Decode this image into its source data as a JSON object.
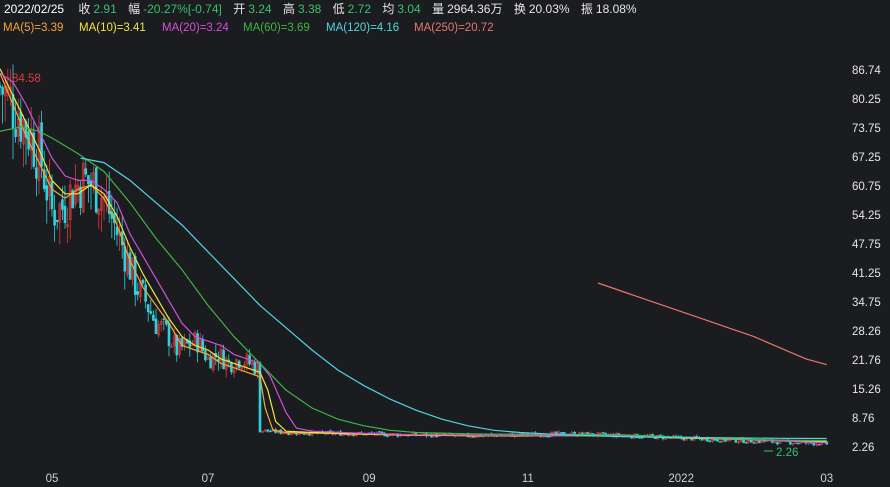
{
  "header": {
    "date": "2022/02/25",
    "close_label": "收",
    "close_value": "2.91",
    "change_label": "幅",
    "change_value": "-20.27%[-0.74]",
    "open_label": "开",
    "open_value": "3.24",
    "high_label": "高",
    "high_value": "3.38",
    "low_label": "低",
    "low_value": "2.72",
    "avg_label": "均",
    "avg_value": "3.04",
    "volume_label": "量",
    "volume_value": "2964.36万",
    "turnover_label": "换",
    "turnover_value": "20.03%",
    "amplitude_label": "振",
    "amplitude_value": "18.08%"
  },
  "ma_legend": [
    {
      "text": "MA(5)=3.39",
      "color": "#f0a63a"
    },
    {
      "text": "MA(10)=3.41",
      "color": "#f2e33c"
    },
    {
      "text": "MA(20)=3.24",
      "color": "#d34fd8"
    },
    {
      "text": "MA(60)=3.69",
      "color": "#3fb43f"
    },
    {
      "text": "MA(120)=4.16",
      "color": "#4fd6e0"
    },
    {
      "text": "MA(250)=20.72",
      "color": "#e8756e"
    }
  ],
  "annotations": {
    "high_mark": "84.58",
    "low_mark": "2.26"
  },
  "chart_data": {
    "type": "line",
    "y_ticks": [
      "86.74",
      "80.25",
      "73.75",
      "67.25",
      "60.75",
      "54.25",
      "47.75",
      "41.25",
      "34.75",
      "28.26",
      "21.76",
      "15.26",
      "8.76",
      "2.26"
    ],
    "x_ticks": [
      {
        "label": "05",
        "x": 20,
        "highlight": false
      },
      {
        "label": "07",
        "x": 80,
        "highlight": false
      },
      {
        "label": "09",
        "x": 142,
        "highlight": false
      },
      {
        "label": "11",
        "x": 203,
        "highlight": false
      },
      {
        "label": "2022",
        "x": 262,
        "highlight": true
      },
      {
        "label": "03",
        "x": 318,
        "highlight": false
      }
    ],
    "ylim": [
      2.26,
      86.74
    ],
    "xlim": [
      0,
      320
    ],
    "grid": false,
    "colors": {
      "up": "#e03a3a",
      "down": "#2fd2de"
    },
    "series": [
      {
        "name": "MA(5)",
        "color": "#f0a63a",
        "values": [
          [
            0,
            86
          ],
          [
            5,
            79
          ],
          [
            10,
            72
          ],
          [
            15,
            66
          ],
          [
            20,
            60
          ],
          [
            25,
            58
          ],
          [
            30,
            60
          ],
          [
            35,
            61
          ],
          [
            40,
            58
          ],
          [
            45,
            52
          ],
          [
            50,
            44
          ],
          [
            55,
            38
          ],
          [
            60,
            34
          ],
          [
            65,
            30
          ],
          [
            70,
            25
          ],
          [
            75,
            24
          ],
          [
            80,
            23
          ],
          [
            85,
            21
          ],
          [
            90,
            20
          ],
          [
            95,
            19
          ],
          [
            100,
            18
          ],
          [
            102,
            11
          ],
          [
            105,
            6
          ],
          [
            110,
            5.5
          ],
          [
            120,
            5.4
          ],
          [
            140,
            5.1
          ],
          [
            160,
            4.9
          ],
          [
            180,
            4.8
          ],
          [
            200,
            4.7
          ],
          [
            220,
            4.9
          ],
          [
            240,
            4.7
          ],
          [
            260,
            4.3
          ],
          [
            280,
            4.0
          ],
          [
            300,
            3.7
          ],
          [
            318,
            3.4
          ]
        ]
      },
      {
        "name": "MA(10)",
        "color": "#f2e33c",
        "values": [
          [
            0,
            87
          ],
          [
            5,
            81
          ],
          [
            10,
            75
          ],
          [
            15,
            69
          ],
          [
            20,
            62
          ],
          [
            25,
            59
          ],
          [
            30,
            59
          ],
          [
            35,
            61
          ],
          [
            40,
            59
          ],
          [
            45,
            54
          ],
          [
            50,
            47
          ],
          [
            55,
            41
          ],
          [
            60,
            36
          ],
          [
            65,
            31
          ],
          [
            70,
            27
          ],
          [
            75,
            25
          ],
          [
            80,
            24
          ],
          [
            85,
            22
          ],
          [
            90,
            21
          ],
          [
            95,
            20
          ],
          [
            100,
            19
          ],
          [
            103,
            15
          ],
          [
            106,
            8
          ],
          [
            110,
            5.8
          ],
          [
            120,
            5.5
          ],
          [
            140,
            5.2
          ],
          [
            160,
            4.9
          ],
          [
            180,
            4.8
          ],
          [
            200,
            4.8
          ],
          [
            220,
            4.8
          ],
          [
            240,
            4.7
          ],
          [
            260,
            4.4
          ],
          [
            280,
            4.1
          ],
          [
            300,
            3.7
          ],
          [
            318,
            3.4
          ]
        ]
      },
      {
        "name": "MA(20)",
        "color": "#d34fd8",
        "values": [
          [
            0,
            86
          ],
          [
            5,
            84
          ],
          [
            10,
            79
          ],
          [
            15,
            73
          ],
          [
            20,
            67
          ],
          [
            25,
            63
          ],
          [
            30,
            62
          ],
          [
            35,
            62
          ],
          [
            40,
            60
          ],
          [
            45,
            57
          ],
          [
            50,
            50
          ],
          [
            55,
            45
          ],
          [
            60,
            40
          ],
          [
            65,
            35
          ],
          [
            70,
            30
          ],
          [
            75,
            27
          ],
          [
            80,
            26
          ],
          [
            85,
            25
          ],
          [
            90,
            23
          ],
          [
            95,
            22
          ],
          [
            100,
            21
          ],
          [
            104,
            18
          ],
          [
            110,
            10
          ],
          [
            114,
            6.5
          ],
          [
            120,
            5.8
          ],
          [
            140,
            5.3
          ],
          [
            160,
            5.0
          ],
          [
            180,
            4.9
          ],
          [
            200,
            4.8
          ],
          [
            220,
            4.8
          ],
          [
            240,
            4.8
          ],
          [
            260,
            4.5
          ],
          [
            280,
            4.2
          ],
          [
            300,
            3.6
          ],
          [
            318,
            3.2
          ]
        ]
      },
      {
        "name": "MA(60)",
        "color": "#3fb43f",
        "values": [
          [
            0,
            73
          ],
          [
            8,
            74
          ],
          [
            15,
            73
          ],
          [
            20,
            71.5
          ],
          [
            30,
            68
          ],
          [
            40,
            64
          ],
          [
            50,
            57
          ],
          [
            60,
            49
          ],
          [
            70,
            42
          ],
          [
            80,
            34
          ],
          [
            90,
            27
          ],
          [
            100,
            21
          ],
          [
            110,
            15
          ],
          [
            120,
            11
          ],
          [
            130,
            8.5
          ],
          [
            140,
            7
          ],
          [
            150,
            6
          ],
          [
            160,
            5.5
          ],
          [
            180,
            5.2
          ],
          [
            200,
            5.1
          ],
          [
            220,
            5.1
          ],
          [
            240,
            5.0
          ],
          [
            260,
            4.5
          ],
          [
            280,
            4.1
          ],
          [
            300,
            3.8
          ],
          [
            318,
            3.7
          ]
        ]
      },
      {
        "name": "MA(120)",
        "color": "#4fd6e0",
        "values": [
          [
            31,
            67
          ],
          [
            40,
            66
          ],
          [
            50,
            62
          ],
          [
            60,
            57
          ],
          [
            70,
            52
          ],
          [
            80,
            46
          ],
          [
            90,
            40
          ],
          [
            100,
            34
          ],
          [
            110,
            29
          ],
          [
            120,
            24
          ],
          [
            130,
            19.5
          ],
          [
            140,
            16
          ],
          [
            150,
            13
          ],
          [
            160,
            10.5
          ],
          [
            170,
            8.5
          ],
          [
            180,
            7
          ],
          [
            190,
            6
          ],
          [
            200,
            5.5
          ],
          [
            220,
            4.9
          ],
          [
            240,
            4.6
          ],
          [
            260,
            4.4
          ],
          [
            280,
            4.3
          ],
          [
            300,
            4.2
          ],
          [
            318,
            4.16
          ]
        ]
      },
      {
        "name": "MA(250)",
        "color": "#e8756e",
        "values": [
          [
            230,
            39
          ],
          [
            240,
            37
          ],
          [
            250,
            35
          ],
          [
            260,
            33
          ],
          [
            270,
            31
          ],
          [
            280,
            29
          ],
          [
            290,
            27
          ],
          [
            300,
            24.5
          ],
          [
            310,
            22
          ],
          [
            318,
            20.7
          ]
        ]
      }
    ],
    "candles": {
      "segments": [
        [
          0,
          83
        ],
        [
          4,
          80
        ],
        [
          8,
          76
        ],
        [
          12,
          72
        ],
        [
          16,
          66
        ],
        [
          20,
          55
        ],
        [
          24,
          56
        ],
        [
          28,
          60
        ],
        [
          32,
          62
        ],
        [
          36,
          61
        ],
        [
          40,
          58
        ],
        [
          44,
          52
        ],
        [
          48,
          46
        ],
        [
          52,
          39
        ],
        [
          56,
          35
        ],
        [
          60,
          30
        ],
        [
          64,
          28
        ],
        [
          68,
          24
        ],
        [
          72,
          25
        ],
        [
          76,
          26
        ],
        [
          80,
          22
        ],
        [
          84,
          23
        ],
        [
          88,
          21
        ],
        [
          92,
          22
        ],
        [
          96,
          21
        ],
        [
          99,
          20
        ],
        [
          100,
          6
        ],
        [
          110,
          5.5
        ],
        [
          140,
          5.2
        ],
        [
          180,
          4.8
        ],
        [
          220,
          5.2
        ],
        [
          250,
          4.6
        ],
        [
          280,
          3.8
        ],
        [
          300,
          3.4
        ],
        [
          318,
          3.0
        ]
      ],
      "spread": 9
    }
  }
}
